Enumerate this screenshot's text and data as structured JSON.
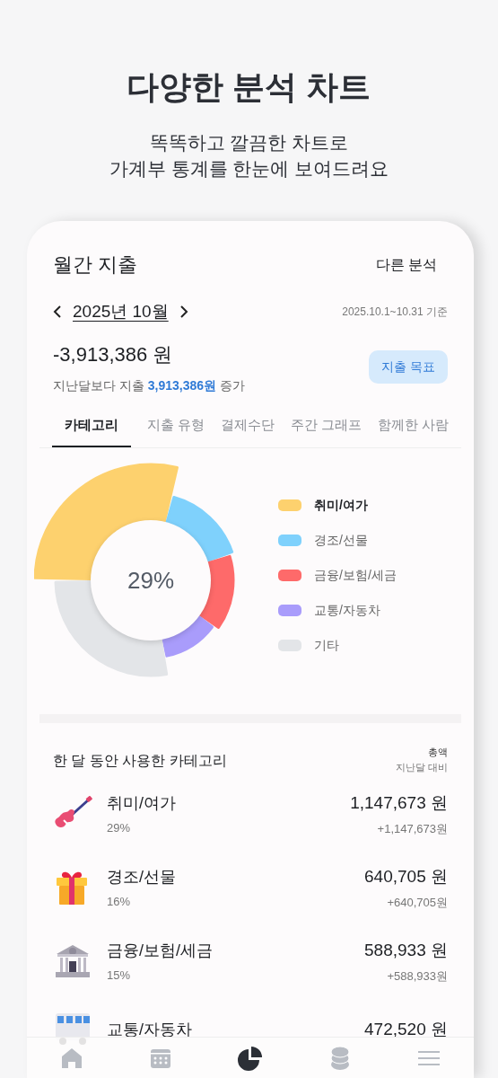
{
  "promo": {
    "title": "다양한 분석 차트",
    "subtitle_lines": [
      "똑똑하고 깔끔한 차트로",
      "가계부 통계를 한눈에 보여드려요"
    ]
  },
  "header": {
    "title": "월간 지출",
    "action": "다른 분석"
  },
  "period": {
    "month": "2025년 10월",
    "range": "2025.10.1~10.31 기준"
  },
  "summary": {
    "total": "-3,913,386 원",
    "compare": "지난달보다 지출 **3,913,386원** 증가",
    "goal_button": "지출 목표"
  },
  "tabs": [
    {
      "label": "카테고리",
      "selected": true
    },
    {
      "label": "지출 유형",
      "selected": false
    },
    {
      "label": "결제수단",
      "selected": false
    },
    {
      "label": "주간 그래프",
      "selected": false
    },
    {
      "label": "함께한 사람",
      "selected": false
    }
  ],
  "chart": {
    "center_label": "29%",
    "legend": [
      {
        "label": "취미/여가",
        "color": "#fdd16e",
        "selected": true
      },
      {
        "label": "경조/선물",
        "color": "#7fd1fc",
        "selected": false
      },
      {
        "label": "금융/보험/세금",
        "color": "#fe6a6a",
        "selected": false
      },
      {
        "label": "교통/자동차",
        "color": "#a99cfb",
        "selected": false
      },
      {
        "label": "기타",
        "color": "#e3e5e8",
        "selected": false
      }
    ]
  },
  "category_list": {
    "title": "한 달 동안 사용한 카테고리",
    "column_total": "총액",
    "column_compare": "지난달 대비",
    "items": [
      {
        "kind": "guitar",
        "name": "취미/여가",
        "percent": "29%",
        "amount": "1,147,673 원",
        "change": "+1,147,673원"
      },
      {
        "kind": "gift",
        "name": "경조/선물",
        "percent": "16%",
        "amount": "640,705 원",
        "change": "+640,705원"
      },
      {
        "kind": "bank",
        "name": "금융/보험/세금",
        "percent": "15%",
        "amount": "588,933 원",
        "change": "+588,933원"
      },
      {
        "kind": "bus",
        "name": "교통/자동차",
        "amount": "472,520 원"
      }
    ]
  },
  "bottom_nav": [
    {
      "kind": "home",
      "selected": false
    },
    {
      "kind": "calendar",
      "selected": false
    },
    {
      "kind": "chart",
      "selected": true
    },
    {
      "kind": "coins",
      "selected": false
    },
    {
      "kind": "menu",
      "selected": false
    }
  ]
}
